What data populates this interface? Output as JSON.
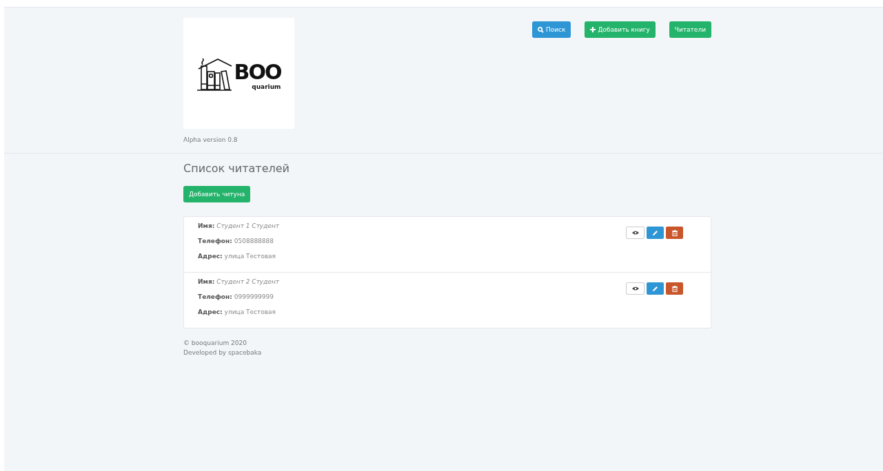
{
  "logo": {
    "title": "BOO",
    "subtitle": "quarium"
  },
  "version": "Alpha version 0.8",
  "nav_buttons": [
    {
      "label": "Поиск",
      "kind": "search"
    },
    {
      "label": "Добавить книгу",
      "kind": "add"
    },
    {
      "label": "Читатели",
      "kind": "plain"
    }
  ],
  "heading": "Список читателей",
  "add_button": "Добавить читуна",
  "readers": [
    {
      "fields": [
        {
          "label": "Имя:",
          "value": "Студент 1 Студент",
          "kind": "italic"
        },
        {
          "label": "Телефон:",
          "value": "0508888888",
          "kind": "plain"
        },
        {
          "label": "Адрес:",
          "value": "улица Тестовая",
          "kind": "plain"
        }
      ]
    },
    {
      "fields": [
        {
          "label": "Имя:",
          "value": "Студент 2 Студент",
          "kind": "italic"
        },
        {
          "label": "Телефон:",
          "value": "0999999999",
          "kind": "plain"
        },
        {
          "label": "Адрес:",
          "value": "улица Тестовая",
          "kind": "plain"
        }
      ]
    }
  ],
  "footer": [
    "© booquarium 2020",
    "Developed by spacebaka"
  ]
}
